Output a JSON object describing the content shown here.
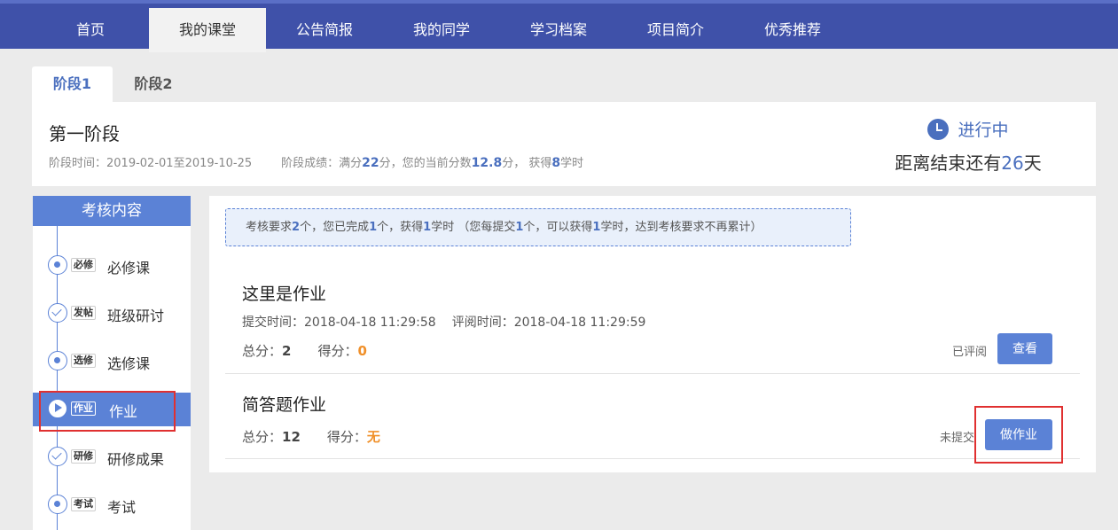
{
  "nav": {
    "items": [
      {
        "label": "首页"
      },
      {
        "label": "我的课堂",
        "active": true
      },
      {
        "label": "公告简报"
      },
      {
        "label": "我的同学"
      },
      {
        "label": "学习档案"
      },
      {
        "label": "项目简介"
      },
      {
        "label": "优秀推荐"
      }
    ]
  },
  "stage_tabs": [
    {
      "label": "阶段1",
      "active": true
    },
    {
      "label": "阶段2"
    }
  ],
  "stage": {
    "title": "第一阶段",
    "time_label": "阶段时间：",
    "time_value": "2019-02-01至2019-10-25",
    "score_prefix": "阶段成绩：满分",
    "full_score": "22",
    "score_mid": "分，您的当前分数",
    "current_score": "12.8",
    "score_mid2": "分，  获得",
    "hours": "8",
    "score_suffix": "学时",
    "status": "进行中",
    "countdown_prefix": "距离结束还有",
    "countdown_days": "26",
    "countdown_suffix": "天"
  },
  "sidebar": {
    "title": "考核内容",
    "items": [
      {
        "badge": "必修",
        "label": "必修课",
        "icon": "dot"
      },
      {
        "badge": "发帖",
        "label": "班级研讨",
        "icon": "check"
      },
      {
        "badge": "选修",
        "label": "选修课",
        "icon": "dot"
      },
      {
        "badge": "作业",
        "label": "作业",
        "icon": "play",
        "active": true
      },
      {
        "badge": "研修",
        "label": "研修成果",
        "icon": "check"
      },
      {
        "badge": "考试",
        "label": "考试",
        "icon": "dot"
      }
    ]
  },
  "notice": {
    "p1": "考核要求",
    "required": "2",
    "p2": "个，您已完成",
    "completed": "1",
    "p3": "个，获得",
    "gained": "1",
    "p4": "学时 （您每提交",
    "per_submit": "1",
    "p5": "个，可以获得",
    "per_hours": "1",
    "p6": "学时，达到考核要求不再累计）"
  },
  "homework": [
    {
      "title": "这里是作业",
      "submit_label": "提交时间：",
      "submit_time": "2018-04-18 11:29:58",
      "review_label": "评阅时间：",
      "review_time": "2018-04-18 11:29:59",
      "total_label": "总分：",
      "total": "2",
      "score_label": "得分：",
      "score": "0",
      "status": "已评阅",
      "action": "查看"
    },
    {
      "title": "简答题作业",
      "total_label": "总分：",
      "total": "12",
      "score_label": "得分：",
      "score": "无",
      "status": "未提交",
      "action": "做作业"
    }
  ],
  "colors": {
    "nav_bg": "#3f51a9",
    "accent": "#5b82d6",
    "highlight": "#e03030",
    "score_orange": "#f0902a"
  }
}
